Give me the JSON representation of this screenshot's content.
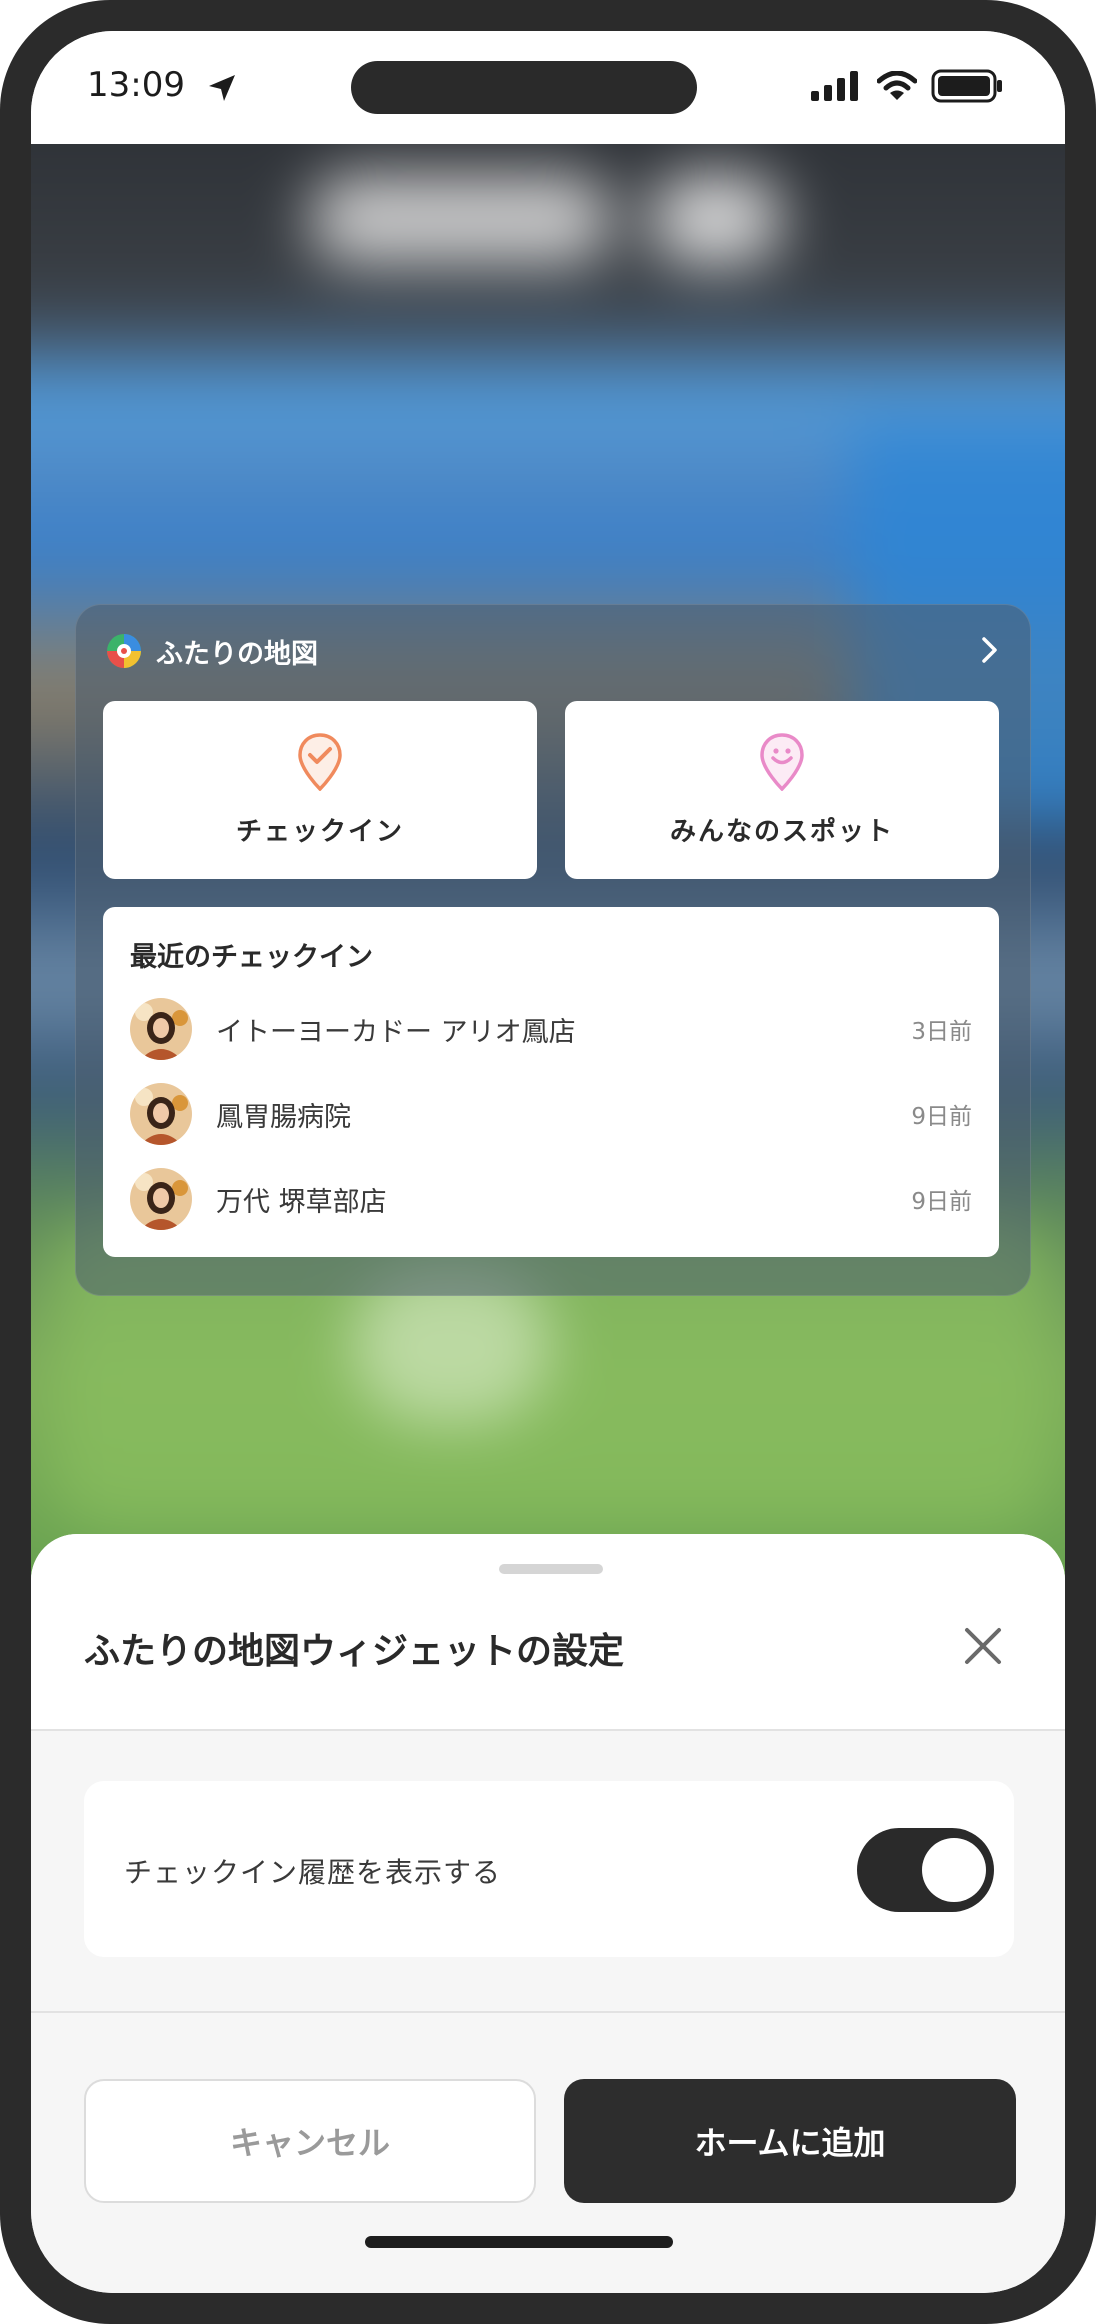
{
  "status_bar": {
    "time": "13:09"
  },
  "widget": {
    "app_name": "ふたりの地図",
    "checkin_label": "チェックイン",
    "spots_label": "みんなのスポット",
    "recent_title": "最近のチェックイン",
    "recent_items": [
      {
        "name": "イトーヨーカドー アリオ鳳店",
        "time": "3日前"
      },
      {
        "name": "鳳胃腸病院",
        "time": "9日前"
      },
      {
        "name": "万代 堺草部店",
        "time": "9日前"
      }
    ]
  },
  "sheet": {
    "title": "ふたりの地図ウィジェットの設定",
    "toggle_label": "チェックイン履歴を表示する",
    "toggle_on": true,
    "cancel_label": "キャンセル",
    "add_label": "ホームに追加"
  },
  "colors": {
    "checkin_icon": "#f08a5d",
    "spots_icon": "#e98ac8",
    "primary_button": "#2d2d2d"
  }
}
